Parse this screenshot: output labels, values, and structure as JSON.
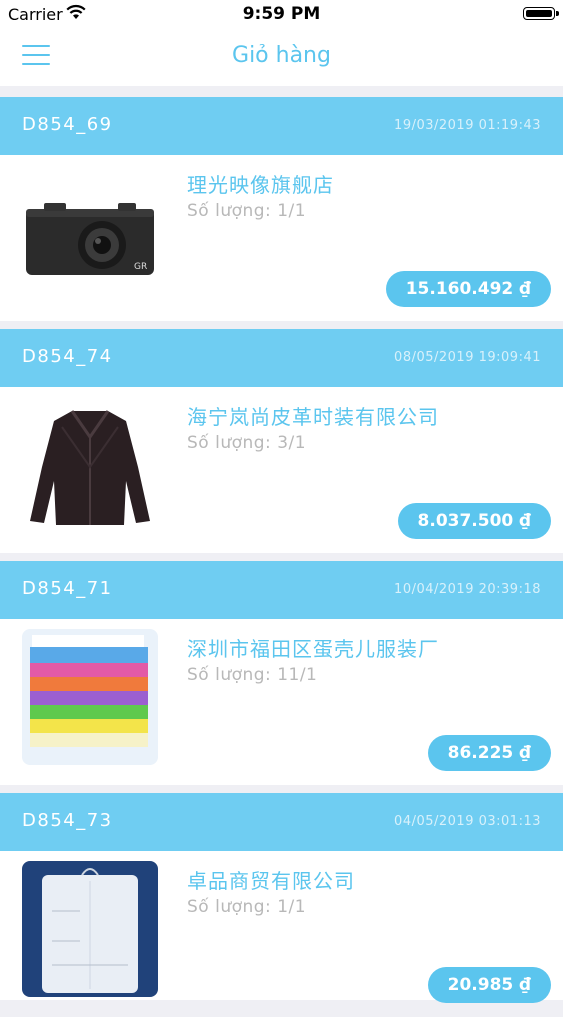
{
  "status_bar": {
    "carrier": "Carrier",
    "time": "9:59 PM"
  },
  "nav": {
    "title": "Giỏ hàng"
  },
  "orders": [
    {
      "code": "D854_69",
      "date": "19/03/2019 01:19:43",
      "shop": "理光映像旗舰店",
      "quantity": "Số lượng: 1/1",
      "price": "15.160.492 ₫",
      "image": "camera-image"
    },
    {
      "code": "D854_74",
      "date": "08/05/2019 19:09:41",
      "shop": "海宁岚尚皮革时装有限公司",
      "quantity": "Số lượng: 3/1",
      "price": "8.037.500 ₫",
      "image": "leather-jacket-image"
    },
    {
      "code": "D854_71",
      "date": "10/04/2019 20:39:18",
      "shop": "深圳市福田区蛋壳儿服装厂",
      "quantity": "Số lượng: 11/1",
      "price": "86.225 ₫",
      "image": "colored-bags-image"
    },
    {
      "code": "D854_73",
      "date": "04/05/2019 03:01:13",
      "shop": "卓品商贸有限公司",
      "quantity": "Số lượng: 1/1",
      "price": "20.985 ₫",
      "image": "garment-cover-image"
    }
  ],
  "colors": {
    "accent": "#5bc5ee",
    "header_bg": "#6fcdf2",
    "muted_text": "#b8b8b8"
  }
}
